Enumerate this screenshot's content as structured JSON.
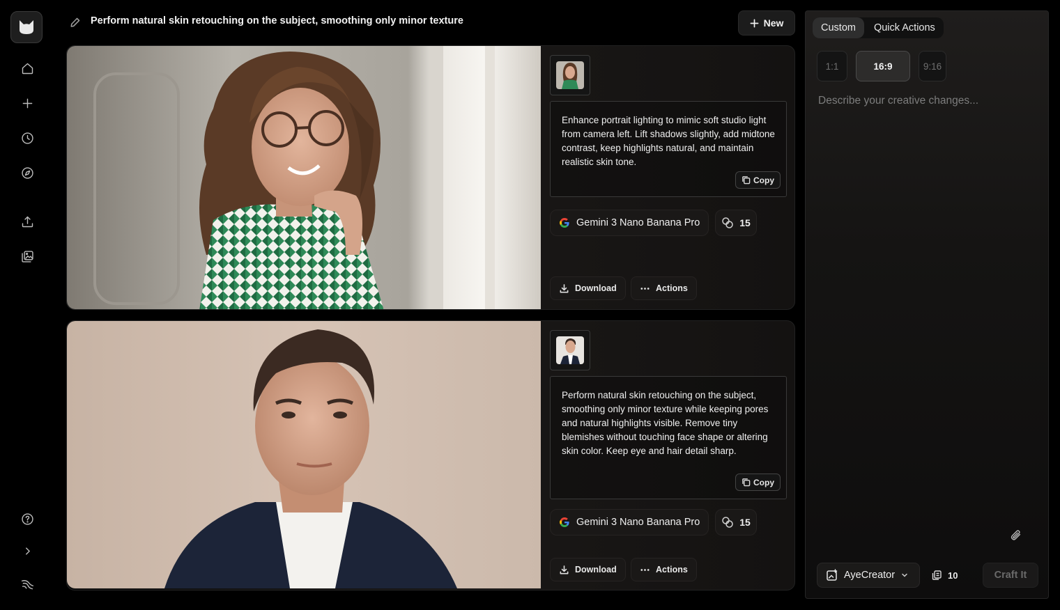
{
  "header": {
    "title": "Perform natural skin retouching on the subject, smoothing only minor texture",
    "new_label": "New"
  },
  "sidebar": {
    "items": [
      {
        "name": "home",
        "icon": "home-icon"
      },
      {
        "name": "create",
        "icon": "plus-icon"
      },
      {
        "name": "history",
        "icon": "clock-icon"
      },
      {
        "name": "explore",
        "icon": "compass-icon"
      },
      {
        "name": "upload",
        "icon": "upload-icon"
      },
      {
        "name": "gallery",
        "icon": "image-gallery-icon"
      }
    ],
    "bottom": [
      {
        "name": "help",
        "icon": "help-icon"
      },
      {
        "name": "expand",
        "icon": "chevron-right-icon"
      },
      {
        "name": "brand",
        "icon": "brand-mark-icon"
      }
    ]
  },
  "results": [
    {
      "prompt": "Enhance portrait lighting to mimic soft studio light from camera left. Lift shadows slightly, add midtone contrast, keep highlights natural, and maintain realistic skin tone.",
      "copy_label": "Copy",
      "model": "Gemini 3 Nano Banana Pro",
      "credits": "15",
      "download_label": "Download",
      "actions_label": "Actions"
    },
    {
      "prompt": "Perform natural skin retouching on the subject, smoothing only minor texture while keeping pores and natural highlights visible. Remove tiny blemishes without touching face shape or altering skin color. Keep eye and hair detail sharp.",
      "copy_label": "Copy",
      "model": "Gemini 3 Nano Banana Pro",
      "credits": "15",
      "download_label": "Download",
      "actions_label": "Actions"
    }
  ],
  "panel": {
    "tabs": [
      {
        "label": "Custom",
        "active": true
      },
      {
        "label": "Quick Actions",
        "active": false
      }
    ],
    "ratios": [
      {
        "label": "1:1",
        "active": false
      },
      {
        "label": "16:9",
        "active": true
      },
      {
        "label": "9:16",
        "active": false
      }
    ],
    "placeholder": "Describe your creative changes...",
    "creator_label": "AyeCreator",
    "credits": "10",
    "submit_label": "Craft It"
  },
  "colors": {
    "background": "#000000",
    "panel": "#1a1817",
    "text": "#efefef",
    "muted": "#7d7d7d"
  }
}
